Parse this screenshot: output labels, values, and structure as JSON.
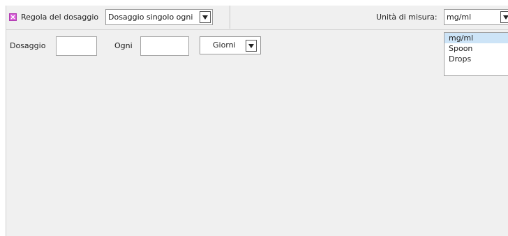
{
  "topbar": {
    "rule_label": "Regola del dosaggio",
    "rule_value": "Dosaggio singolo ogni",
    "unit_label": "Unità di misura:",
    "unit_value": "mg/ml"
  },
  "form": {
    "dose_label": "Dosaggio",
    "dose_value": "",
    "every_label": "Ogni",
    "every_value": "",
    "period_value": "Giorni"
  },
  "unit_dropdown": {
    "options": [
      "mg/ml",
      "Spoon",
      "Drops"
    ],
    "selected_index": 0
  },
  "icons": {
    "rule_icon": "pink-square-cross-icon"
  },
  "colors": {
    "panel_bg": "#f0f0f0",
    "icon": "#d85fd8",
    "selected_item": "#cde4f7"
  }
}
